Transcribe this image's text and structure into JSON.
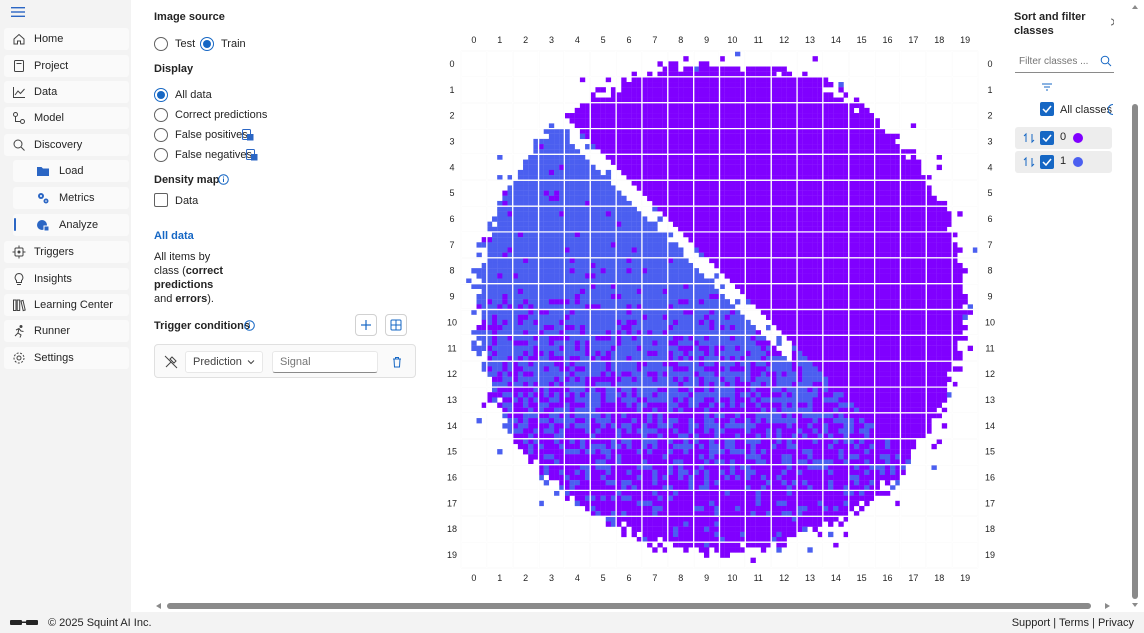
{
  "nav": {
    "items": [
      {
        "label": "Home",
        "icon": "home-icon"
      },
      {
        "label": "Project",
        "icon": "project-icon"
      },
      {
        "label": "Data",
        "icon": "data-chart-icon"
      },
      {
        "label": "Model",
        "icon": "model-icon"
      },
      {
        "label": "Discovery",
        "icon": "discovery-search-icon"
      },
      {
        "label": "Load",
        "icon": "folder-icon"
      },
      {
        "label": "Metrics",
        "icon": "gears-icon"
      },
      {
        "label": "Analyze",
        "icon": "analyze-icon"
      },
      {
        "label": "Triggers",
        "icon": "trigger-icon"
      },
      {
        "label": "Insights",
        "icon": "lightbulb-icon"
      },
      {
        "label": "Learning Center",
        "icon": "library-icon"
      },
      {
        "label": "Runner",
        "icon": "runner-icon"
      },
      {
        "label": "Settings",
        "icon": "settings-icon"
      }
    ]
  },
  "panel": {
    "image_source_title": "Image source",
    "source_options": [
      "Test",
      "Train"
    ],
    "source_selected": "Train",
    "display_title": "Display",
    "display_options": [
      "All data",
      "Correct predictions",
      "False positives",
      "False negatives"
    ],
    "display_selected": "All data",
    "density_title": "Density map",
    "density_checkbox": "Data",
    "section_link": "All data",
    "desc_prefix": "All items by class (",
    "desc_bold1": "correct predictions",
    "desc_mid": " and ",
    "desc_bold2": "errors",
    "desc_suffix": ").",
    "trigger_title": "Trigger conditions",
    "trigger_field": "Prediction",
    "signal_placeholder": "Signal"
  },
  "grid": {
    "x_ticks": [
      "0",
      "1",
      "2",
      "3",
      "4",
      "5",
      "6",
      "7",
      "8",
      "9",
      "10",
      "11",
      "12",
      "13",
      "14",
      "15",
      "16",
      "17",
      "18",
      "19"
    ],
    "y_ticks": [
      "0",
      "1",
      "2",
      "3",
      "4",
      "5",
      "6",
      "7",
      "8",
      "9",
      "10",
      "11",
      "12",
      "13",
      "14",
      "15",
      "16",
      "17",
      "18",
      "19"
    ],
    "colors": {
      "class0": "#8000ff",
      "class1": "#4b5ff0",
      "grid": "#ffffff"
    }
  },
  "sort": {
    "title": "Sort and filter classes",
    "filter_placeholder": "Filter classes ...",
    "all_label": "All classes",
    "classes": [
      {
        "label": "0",
        "color": "#8000ff"
      },
      {
        "label": "1",
        "color": "#4b5ff0"
      }
    ]
  },
  "footer": {
    "copyright": "© 2025 Squint AI Inc.",
    "support": "Support",
    "terms": "Terms",
    "privacy": "Privacy",
    "sep": " | "
  }
}
